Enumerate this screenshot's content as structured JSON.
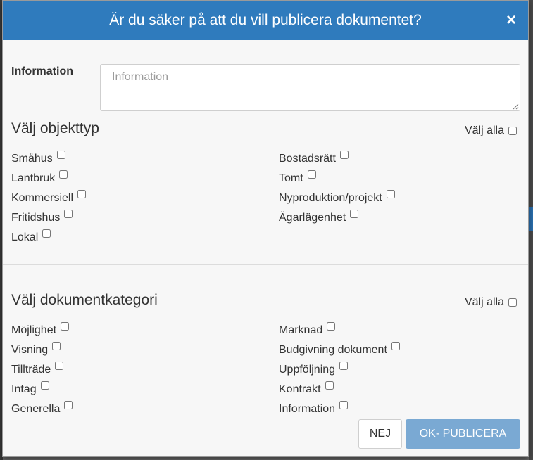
{
  "dialog": {
    "title": "Är du säker på att du vill publicera dokumentet?",
    "close_label": "×"
  },
  "information": {
    "label": "Information",
    "placeholder": "Information",
    "value": ""
  },
  "object_types": {
    "title": "Välj objekttyp",
    "select_all_label": "Välj alla",
    "select_all_checked": false,
    "left": [
      {
        "label": "Småhus",
        "checked": false
      },
      {
        "label": "Lantbruk",
        "checked": false
      },
      {
        "label": "Kommersiell",
        "checked": false
      },
      {
        "label": "Fritidshus",
        "checked": false
      },
      {
        "label": "Lokal",
        "checked": false
      }
    ],
    "right": [
      {
        "label": "Bostadsrätt",
        "checked": false
      },
      {
        "label": "Tomt",
        "checked": false
      },
      {
        "label": "Nyproduktion/projekt",
        "checked": false
      },
      {
        "label": "Ägarlägenhet",
        "checked": false
      }
    ]
  },
  "document_categories": {
    "title": "Välj dokumentkategori",
    "select_all_label": "Välj alla",
    "select_all_checked": false,
    "left": [
      {
        "label": "Möjlighet",
        "checked": false
      },
      {
        "label": "Visning",
        "checked": false
      },
      {
        "label": "Tillträde",
        "checked": false
      },
      {
        "label": "Intag",
        "checked": false
      },
      {
        "label": "Generella",
        "checked": false
      }
    ],
    "right": [
      {
        "label": "Marknad",
        "checked": false
      },
      {
        "label": "Budgivning dokument",
        "checked": false
      },
      {
        "label": "Uppföljning",
        "checked": false
      },
      {
        "label": "Kontrakt",
        "checked": false
      },
      {
        "label": "Information",
        "checked": false
      }
    ]
  },
  "buttons": {
    "cancel_label": "NEJ",
    "confirm_label": "OK- PUBLICERA"
  },
  "colors": {
    "header_bg": "#2f7bbd",
    "confirm_bg": "#7aa9d3"
  }
}
